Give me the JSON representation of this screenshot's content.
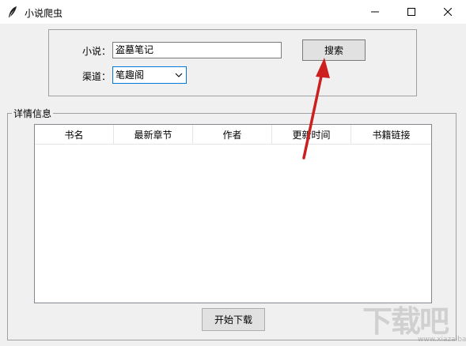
{
  "window": {
    "title": "小说爬虫",
    "minimize_glyph": "—",
    "maximize_glyph": "☐",
    "close_glyph": "✕"
  },
  "form": {
    "novel_label": "小说：",
    "novel_value": "盗墓笔记",
    "channel_label": "渠道：",
    "channel_value": "笔趣阁",
    "search_button": "搜索"
  },
  "details": {
    "legend": "详情信息",
    "columns": [
      "书名",
      "最新章节",
      "作者",
      "更新时间",
      "书籍链接"
    ]
  },
  "actions": {
    "download_button": "开始下载"
  },
  "watermark": {
    "text": "下载吧",
    "url": "www.xiazaiba.com"
  },
  "colors": {
    "annotation_arrow": "#cc1f1f",
    "focus_border": "#0078d7"
  }
}
